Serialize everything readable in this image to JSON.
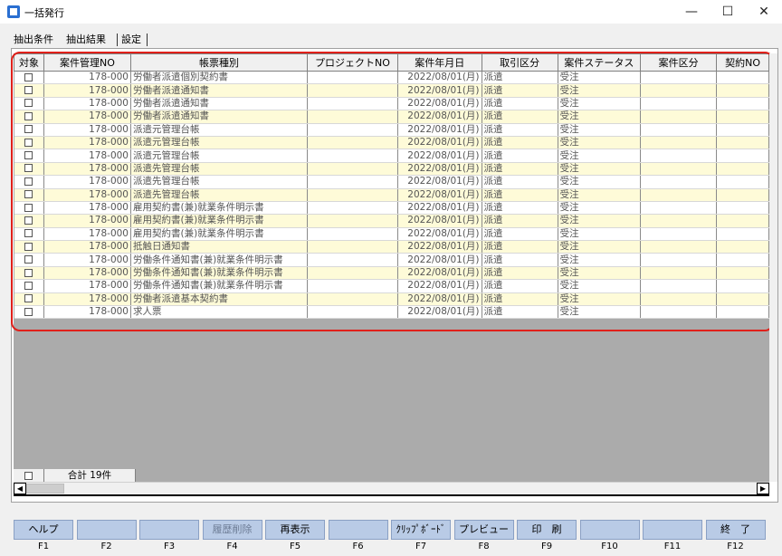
{
  "window": {
    "title": "一括発行",
    "minimize": "—",
    "maximize": "☐",
    "close": "✕"
  },
  "tabs": [
    {
      "label": "抽出条件"
    },
    {
      "label": "抽出結果"
    },
    {
      "label": "設定"
    }
  ],
  "grid": {
    "columns": [
      "対象",
      "案件管理NO",
      "帳票種別",
      "プロジェクトNO",
      "案件年月日",
      "取引区分",
      "案件ステータス",
      "案件区分",
      "契約NO"
    ],
    "rows": [
      {
        "no": "178-000",
        "type": "労働者派遣個別契約書",
        "project": "",
        "date": "2022/08/01(月)",
        "trade": "派遣",
        "status": "受注",
        "category": ""
      },
      {
        "no": "178-000",
        "type": "労働者派遣通知書",
        "project": "",
        "date": "2022/08/01(月)",
        "trade": "派遣",
        "status": "受注",
        "category": ""
      },
      {
        "no": "178-000",
        "type": "労働者派遣通知書",
        "project": "",
        "date": "2022/08/01(月)",
        "trade": "派遣",
        "status": "受注",
        "category": ""
      },
      {
        "no": "178-000",
        "type": "労働者派遣通知書",
        "project": "",
        "date": "2022/08/01(月)",
        "trade": "派遣",
        "status": "受注",
        "category": ""
      },
      {
        "no": "178-000",
        "type": "派遣元管理台帳",
        "project": "",
        "date": "2022/08/01(月)",
        "trade": "派遣",
        "status": "受注",
        "category": ""
      },
      {
        "no": "178-000",
        "type": "派遣元管理台帳",
        "project": "",
        "date": "2022/08/01(月)",
        "trade": "派遣",
        "status": "受注",
        "category": ""
      },
      {
        "no": "178-000",
        "type": "派遣元管理台帳",
        "project": "",
        "date": "2022/08/01(月)",
        "trade": "派遣",
        "status": "受注",
        "category": ""
      },
      {
        "no": "178-000",
        "type": "派遣先管理台帳",
        "project": "",
        "date": "2022/08/01(月)",
        "trade": "派遣",
        "status": "受注",
        "category": ""
      },
      {
        "no": "178-000",
        "type": "派遣先管理台帳",
        "project": "",
        "date": "2022/08/01(月)",
        "trade": "派遣",
        "status": "受注",
        "category": ""
      },
      {
        "no": "178-000",
        "type": "派遣先管理台帳",
        "project": "",
        "date": "2022/08/01(月)",
        "trade": "派遣",
        "status": "受注",
        "category": ""
      },
      {
        "no": "178-000",
        "type": "雇用契約書(兼)就業条件明示書",
        "project": "",
        "date": "2022/08/01(月)",
        "trade": "派遣",
        "status": "受注",
        "category": ""
      },
      {
        "no": "178-000",
        "type": "雇用契約書(兼)就業条件明示書",
        "project": "",
        "date": "2022/08/01(月)",
        "trade": "派遣",
        "status": "受注",
        "category": ""
      },
      {
        "no": "178-000",
        "type": "雇用契約書(兼)就業条件明示書",
        "project": "",
        "date": "2022/08/01(月)",
        "trade": "派遣",
        "status": "受注",
        "category": ""
      },
      {
        "no": "178-000",
        "type": "抵触日通知書",
        "project": "",
        "date": "2022/08/01(月)",
        "trade": "派遣",
        "status": "受注",
        "category": ""
      },
      {
        "no": "178-000",
        "type": "労働条件通知書(兼)就業条件明示書",
        "project": "",
        "date": "2022/08/01(月)",
        "trade": "派遣",
        "status": "受注",
        "category": ""
      },
      {
        "no": "178-000",
        "type": "労働条件通知書(兼)就業条件明示書",
        "project": "",
        "date": "2022/08/01(月)",
        "trade": "派遣",
        "status": "受注",
        "category": ""
      },
      {
        "no": "178-000",
        "type": "労働条件通知書(兼)就業条件明示書",
        "project": "",
        "date": "2022/08/01(月)",
        "trade": "派遣",
        "status": "受注",
        "category": ""
      },
      {
        "no": "178-000",
        "type": "労働者派遣基本契約書",
        "project": "",
        "date": "2022/08/01(月)",
        "trade": "派遣",
        "status": "受注",
        "category": ""
      },
      {
        "no": "178-000",
        "type": "求人票",
        "project": "",
        "date": "2022/08/01(月)",
        "trade": "派遣",
        "status": "受注",
        "category": ""
      }
    ]
  },
  "total": {
    "label": "合計 19件"
  },
  "scroll": {
    "left": "◀",
    "right": "▶"
  },
  "fkeys": [
    {
      "label": "ヘルプ",
      "key": "F1",
      "disabled": false
    },
    {
      "label": "",
      "key": "F2",
      "disabled": false
    },
    {
      "label": "",
      "key": "F3",
      "disabled": false
    },
    {
      "label": "履歴削除",
      "key": "F4",
      "disabled": true
    },
    {
      "label": "再表示",
      "key": "F5",
      "disabled": false
    },
    {
      "label": "",
      "key": "F6",
      "disabled": false
    },
    {
      "label": "ｸﾘｯﾌﾟﾎﾞｰﾄﾞ",
      "key": "F7",
      "disabled": false
    },
    {
      "label": "プレビュー",
      "key": "F8",
      "disabled": false
    },
    {
      "label": "印　刷",
      "key": "F9",
      "disabled": false
    },
    {
      "label": "",
      "key": "F10",
      "disabled": false
    },
    {
      "label": "",
      "key": "F11",
      "disabled": false
    },
    {
      "label": "終　了",
      "key": "F12",
      "disabled": false
    }
  ]
}
